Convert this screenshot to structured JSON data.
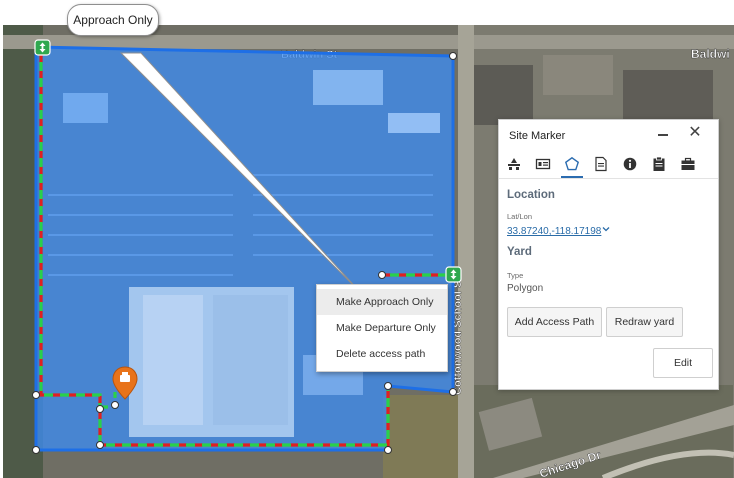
{
  "map": {
    "street_labels": [
      "Baldwin St",
      "Baldwi",
      "Cottonwood School St",
      "Chicago Dr"
    ],
    "colors": {
      "zone_fill": "#3e8cf0",
      "zone_border": "#1e6fe6",
      "route_red": "#e02020",
      "route_green": "#2ad04a",
      "marker": "#e8731a"
    },
    "path_handle_icon": "up-down-arrow-icon",
    "site_marker_icon": "location-pin-icon"
  },
  "callout": {
    "text": "Approach Only"
  },
  "context_menu": {
    "items": [
      {
        "label": "Make Approach Only"
      },
      {
        "label": "Make Departure Only"
      },
      {
        "label": "Delete access path"
      }
    ],
    "hovered_index": 0
  },
  "panel": {
    "title": "Site Marker",
    "tabs": [
      {
        "icon": "site-tab-icon"
      },
      {
        "icon": "id-card-icon"
      },
      {
        "icon": "polygon-icon",
        "active": true
      },
      {
        "icon": "notes-icon"
      },
      {
        "icon": "info-icon"
      },
      {
        "icon": "clipboard-icon"
      },
      {
        "icon": "briefcase-icon"
      }
    ],
    "location_heading": "Location",
    "latlon_label": "Lat/Lon",
    "latlon_value": "33.87240,-118.17198",
    "yard_heading": "Yard",
    "type_label": "Type",
    "type_value": "Polygon",
    "add_access_path_label": "Add Access Path",
    "redraw_yard_label": "Redraw yard",
    "edit_label": "Edit",
    "accent_color": "#2b6cb0"
  }
}
